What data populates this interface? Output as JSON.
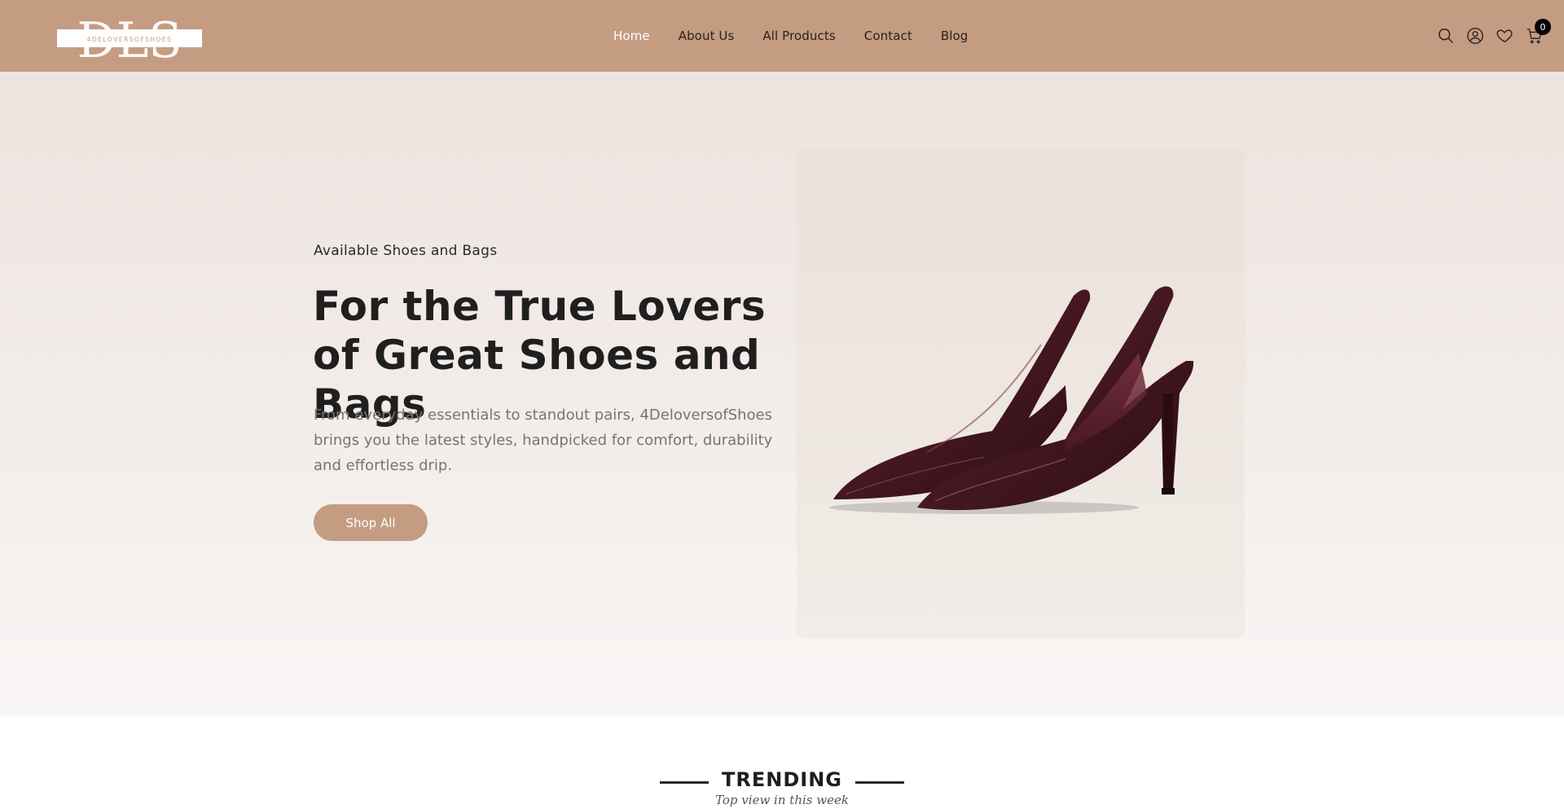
{
  "header": {
    "logo_text": "DLS",
    "logo_subtext": "4DELOVERSOFSHOES",
    "nav": [
      {
        "label": "Home",
        "active": true
      },
      {
        "label": "About Us",
        "active": false
      },
      {
        "label": "All Products",
        "active": false
      },
      {
        "label": "Contact",
        "active": false
      },
      {
        "label": "Blog",
        "active": false
      }
    ],
    "icons": [
      "search-icon",
      "user-icon",
      "heart-icon",
      "cart-icon"
    ],
    "cart_count": "0"
  },
  "hero": {
    "kicker": "Available Shoes and Bags",
    "title": "For the True Lovers of Great Shoes and Bags",
    "description": "From everyday essentials to standout pairs, 4DeloversofShoes brings you the latest styles, handpicked for comfort, durability and effortless drip.",
    "cta_label": "Shop All"
  },
  "trending": {
    "title": "TRENDING",
    "subtitle": "Top view in this week"
  },
  "colors": {
    "brand": "#c49c82",
    "text_dark": "#1f1f1f",
    "text_muted": "#7b7370",
    "shoe": "#4a1a24"
  }
}
